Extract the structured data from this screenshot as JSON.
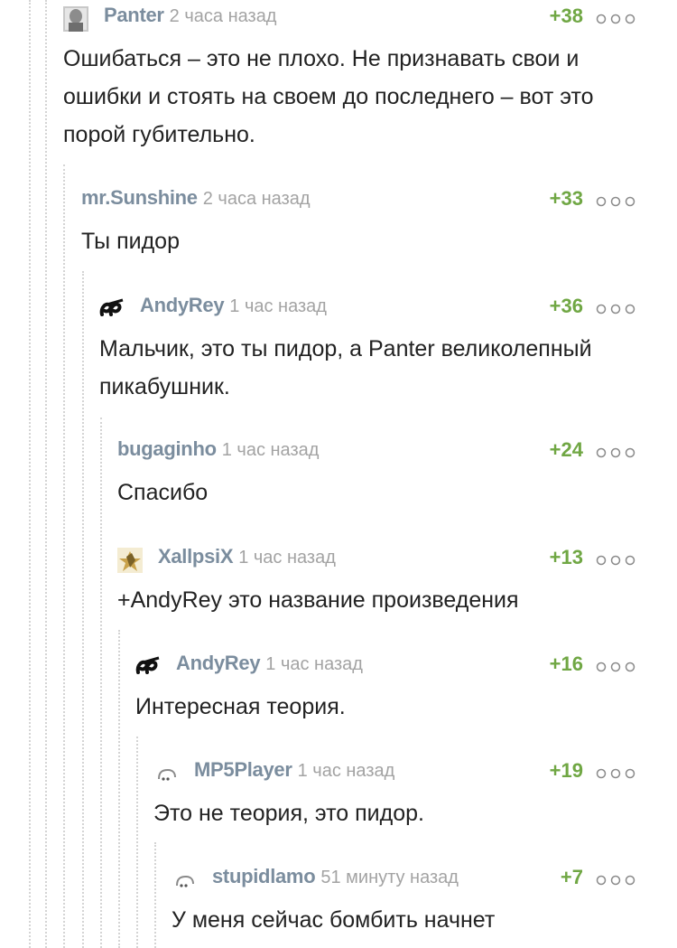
{
  "comments": [
    {
      "username": "Panter",
      "time": "2 часа назад",
      "rating": "+38",
      "text": "Ошибаться – это не плохо. Не признавать свои и ошибки и стоять на своем до последнего – вот это порой губительно.",
      "avatar_icon": "panter-avatar"
    },
    {
      "username": "mr.Sunshine",
      "time": "2 часа назад",
      "rating": "+33",
      "text": "Ты пидор",
      "avatar_icon": "none"
    },
    {
      "username": "AndyRey",
      "time": "1 час назад",
      "rating": "+36",
      "text": "Мальчик, это ты пидор, а Panter великолепный пикабушник.",
      "avatar_icon": "andyrey-logo-avatar"
    },
    {
      "username": "bugaginho",
      "time": "1 час назад",
      "rating": "+24",
      "text": "Спасибо",
      "avatar_icon": "none"
    },
    {
      "username": "XallpsiX",
      "time": "1 час назад",
      "rating": "+13",
      "text": "+AndyRey это название произведения",
      "avatar_icon": "xallpsix-avatar"
    },
    {
      "username": "AndyRey",
      "time": "1 час назад",
      "rating": "+16",
      "text": "Интересная теория.",
      "avatar_icon": "andyrey-logo-avatar"
    },
    {
      "username": "MP5Player",
      "time": "1 час назад",
      "rating": "+19",
      "text": "Это не теория, это пидор.",
      "avatar_icon": "default-avatar"
    },
    {
      "username": "stupidlamo",
      "time": "51 минуту назад",
      "rating": "+7",
      "text": "У меня сейчас бомбить начнет",
      "avatar_icon": "default-avatar"
    }
  ],
  "colors": {
    "username": "#7b8d9e",
    "timestamp": "#a3a3a3",
    "rating": "#70a744",
    "thread_line": "#d4d4d4"
  }
}
